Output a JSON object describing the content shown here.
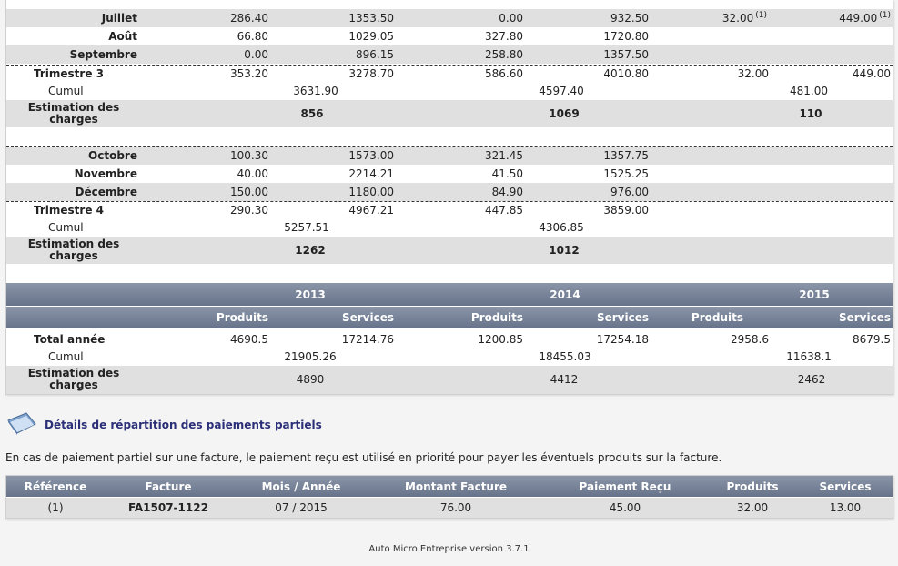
{
  "q3": {
    "months": [
      {
        "name": "Juillet",
        "v1": "286.40",
        "v2": "1353.50",
        "v3": "0.00",
        "v4": "932.50",
        "v5": "32.00",
        "v5_note": "(1)",
        "v6": "449.00",
        "v6_note": "(1)"
      },
      {
        "name": "Août",
        "v1": "66.80",
        "v2": "1029.05",
        "v3": "327.80",
        "v4": "1720.80"
      },
      {
        "name": "Septembre",
        "v1": "0.00",
        "v2": "896.15",
        "v3": "258.80",
        "v4": "1357.50"
      }
    ],
    "total": {
      "label": "Trimestre 3",
      "v1": "353.20",
      "v2": "3278.70",
      "v3": "586.60",
      "v4": "4010.80",
      "v5": "32.00",
      "v6": "449.00"
    },
    "cumul": {
      "label": "Cumul",
      "a": "3631.90",
      "b": "4597.40",
      "c": "481.00"
    },
    "estimation": {
      "label_line1": "Estimation des",
      "label_line2": "charges",
      "a": "856",
      "b": "1069",
      "c": "110"
    }
  },
  "q4": {
    "months": [
      {
        "name": "Octobre",
        "v1": "100.30",
        "v2": "1573.00",
        "v3": "321.45",
        "v4": "1357.75"
      },
      {
        "name": "Novembre",
        "v1": "40.00",
        "v2": "2214.21",
        "v3": "41.50",
        "v4": "1525.25"
      },
      {
        "name": "Décembre",
        "v1": "150.00",
        "v2": "1180.00",
        "v3": "84.90",
        "v4": "976.00"
      }
    ],
    "total": {
      "label": "Trimestre 4",
      "v1": "290.30",
      "v2": "4967.21",
      "v3": "447.85",
      "v4": "3859.00"
    },
    "cumul": {
      "label": "Cumul",
      "a": "5257.51",
      "b": "4306.85"
    },
    "estimation": {
      "label_line1": "Estimation des",
      "label_line2": "charges",
      "a": "1262",
      "b": "1012"
    }
  },
  "years": [
    "2013",
    "2014",
    "2015"
  ],
  "year_cols": [
    "Produits",
    "Services",
    "Produits",
    "Services",
    "Produits",
    "Services"
  ],
  "annual": {
    "label": "Total année",
    "values": [
      "4690.5",
      "17214.76",
      "1200.85",
      "17254.18",
      "2958.6",
      "8679.5"
    ],
    "cumul_label": "Cumul",
    "cumul": [
      "21905.26",
      "18455.03",
      "11638.1"
    ],
    "est_line1": "Estimation des",
    "est_line2": "charges",
    "estimation": [
      "4890",
      "4412",
      "2462"
    ]
  },
  "partial": {
    "title": "Détails de répartition des paiements partiels",
    "description": "En cas de paiement partiel sur une facture, le paiement reçu est utilisé en priorité pour payer les éventuels produits sur la facture.",
    "headers": [
      "Référence",
      "Facture",
      "Mois / Année",
      "Montant Facture",
      "Paiement Reçu",
      "Produits",
      "Services"
    ],
    "row": [
      "(1)",
      "FA1507-1122",
      "07 / 2015",
      "76.00",
      "45.00",
      "32.00",
      "13.00"
    ]
  },
  "footer": "Auto Micro Entreprise version 3.7.1",
  "colors": {
    "header_top": "#8a95a8",
    "header_bottom": "#67738a",
    "shade": "#e0e0e0",
    "title": "#2b2f78"
  }
}
